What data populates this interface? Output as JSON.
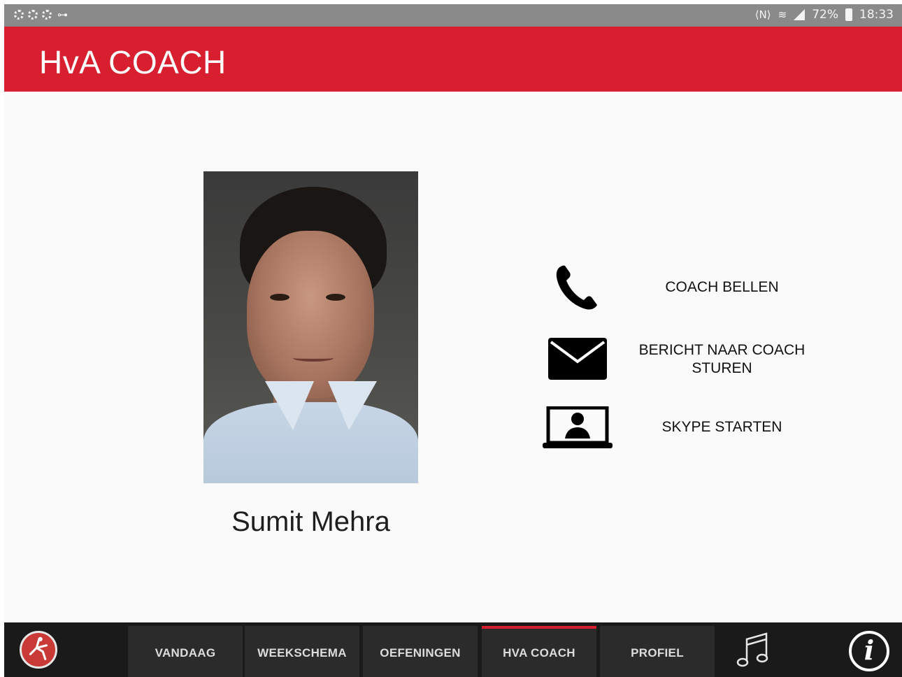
{
  "status_bar": {
    "battery": "72%",
    "time": "18:33",
    "left_icons": [
      "settings-icon",
      "settings-icon",
      "settings-icon",
      "key-icon"
    ],
    "right_icons": [
      "nfc-icon",
      "wifi-icon",
      "signal-icon",
      "battery-icon"
    ]
  },
  "app_bar": {
    "title": "HvA COACH",
    "color": "#d71f30"
  },
  "coach": {
    "name": "Sumit Mehra",
    "photo": "coach-portrait"
  },
  "actions": [
    {
      "label": "COACH BELLEN",
      "icon": "phone-icon"
    },
    {
      "label": "BERICHT NAAR COACH STUREN",
      "icon": "envelope-icon"
    },
    {
      "label": "SKYPE STARTEN",
      "icon": "laptop-user-icon"
    }
  ],
  "bottom_nav": {
    "logo_icon": "app-logo-icon",
    "tabs": [
      {
        "label": "VANDAAG",
        "active": false
      },
      {
        "label": "WEEKSCHEMA",
        "active": false
      },
      {
        "label": "OEFENINGEN",
        "active": false
      },
      {
        "label": "HVA COACH",
        "active": true
      },
      {
        "label": "PROFIEL",
        "active": false
      }
    ],
    "music_icon": "music-note-icon",
    "info_glyph": "i",
    "active_color": "#d71f30"
  }
}
